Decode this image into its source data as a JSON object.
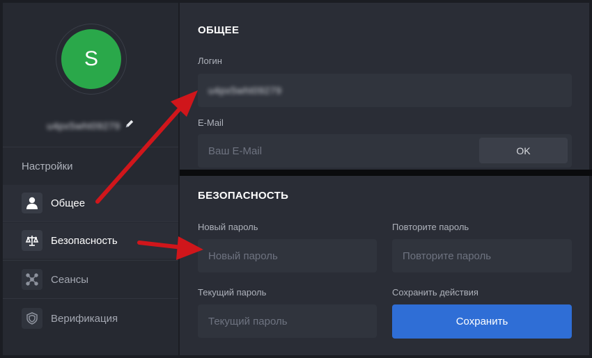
{
  "profile": {
    "avatar_letter": "S",
    "username": "u4px5wht09279",
    "avatar_color": "#2aa84a"
  },
  "sidebar": {
    "header": "Настройки",
    "items": [
      {
        "label": "Общее",
        "icon": "user-icon",
        "active": true
      },
      {
        "label": "Безопасность",
        "icon": "scales-icon",
        "active": true
      },
      {
        "label": "Сеансы",
        "icon": "network-icon",
        "active": false
      },
      {
        "label": "Верификация",
        "icon": "shield-icon",
        "active": false
      }
    ]
  },
  "general": {
    "title": "ОБЩЕЕ",
    "login_label": "Логин",
    "login_value": "u4px5wht09279",
    "email_label": "E-Mail",
    "email_placeholder": "Ваш E-Mail",
    "ok_label": "OK"
  },
  "security": {
    "title": "БЕЗОПАСНОСТЬ",
    "new_password_label": "Новый пароль",
    "new_password_placeholder": "Новый пароль",
    "repeat_password_label": "Повторите пароль",
    "repeat_password_placeholder": "Повторите пароль",
    "current_password_label": "Текущий пароль",
    "current_password_placeholder": "Текущий пароль",
    "save_actions_label": "Сохранить действия",
    "save_label": "Сохранить"
  },
  "colors": {
    "accent": "#2f6ed6",
    "arrow": "#d0161b"
  }
}
